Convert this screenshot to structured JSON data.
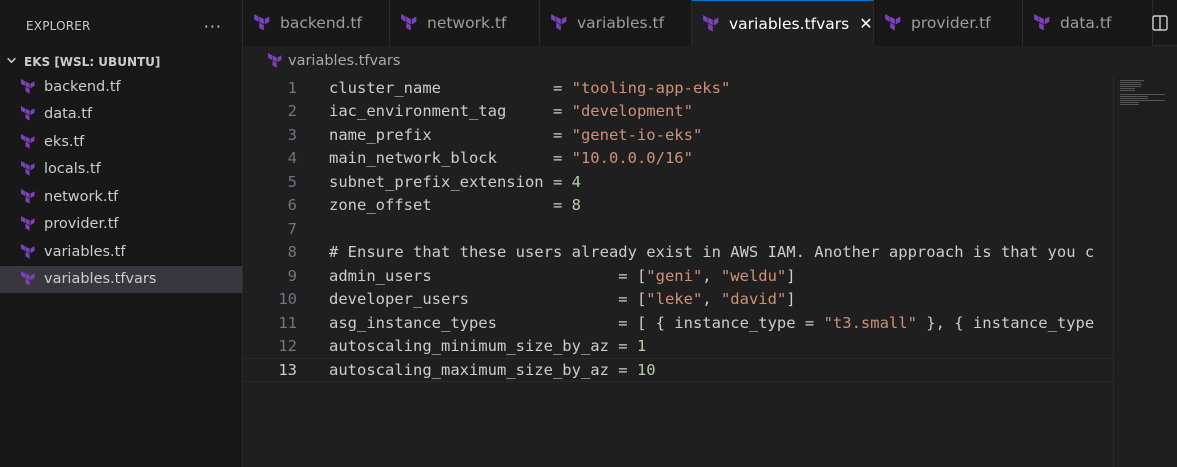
{
  "explorer": {
    "title": "EXPLORER",
    "more_label": "···",
    "folder": "EKS [WSL: UBUNTU]",
    "files": [
      {
        "name": "backend.tf"
      },
      {
        "name": "data.tf"
      },
      {
        "name": "eks.tf"
      },
      {
        "name": "locals.tf"
      },
      {
        "name": "network.tf"
      },
      {
        "name": "provider.tf"
      },
      {
        "name": "variables.tf"
      },
      {
        "name": "variables.tfvars",
        "selected": true
      }
    ]
  },
  "tabs": [
    {
      "label": "backend.tf"
    },
    {
      "label": "network.tf"
    },
    {
      "label": "variables.tf"
    },
    {
      "label": "variables.tfvars",
      "active": true,
      "close": "✕"
    },
    {
      "label": "provider.tf"
    },
    {
      "label": "data.tf"
    }
  ],
  "breadcrumb": "variables.tfvars",
  "colors": {
    "terraform": "#7b42bc",
    "accent": "#0078d4",
    "string": "#ce9178",
    "number": "#b5cea8"
  },
  "editor": {
    "current_line": "13",
    "lines": [
      {
        "n": "1",
        "parts": [
          {
            "t": "cluster_name            = "
          },
          {
            "t": "\"tooling-app-eks\"",
            "c": "str"
          }
        ]
      },
      {
        "n": "2",
        "parts": [
          {
            "t": "iac_environment_tag     = "
          },
          {
            "t": "\"development\"",
            "c": "str"
          }
        ]
      },
      {
        "n": "3",
        "parts": [
          {
            "t": "name_prefix             = "
          },
          {
            "t": "\"genet-io-eks\"",
            "c": "str"
          }
        ]
      },
      {
        "n": "4",
        "parts": [
          {
            "t": "main_network_block      = "
          },
          {
            "t": "\"10.0.0.0/16\"",
            "c": "str"
          }
        ]
      },
      {
        "n": "5",
        "parts": [
          {
            "t": "subnet_prefix_extension = "
          },
          {
            "t": "4",
            "c": "num"
          }
        ]
      },
      {
        "n": "6",
        "parts": [
          {
            "t": "zone_offset             = "
          },
          {
            "t": "8",
            "c": "num"
          }
        ]
      },
      {
        "n": "7",
        "parts": [
          {
            "t": ""
          }
        ]
      },
      {
        "n": "8",
        "parts": [
          {
            "t": "# Ensure that these users already exist in AWS IAM. Another approach is that you c",
            "c": "cmt"
          }
        ]
      },
      {
        "n": "9",
        "parts": [
          {
            "t": "admin_users                    = ["
          },
          {
            "t": "\"geni\"",
            "c": "str"
          },
          {
            "t": ", "
          },
          {
            "t": "\"weldu\"",
            "c": "str"
          },
          {
            "t": "]"
          }
        ]
      },
      {
        "n": "10",
        "parts": [
          {
            "t": "developer_users                = ["
          },
          {
            "t": "\"leke\"",
            "c": "str"
          },
          {
            "t": ", "
          },
          {
            "t": "\"david\"",
            "c": "str"
          },
          {
            "t": "]"
          }
        ]
      },
      {
        "n": "11",
        "parts": [
          {
            "t": "asg_instance_types             = [ { instance_type = "
          },
          {
            "t": "\"t3.small\"",
            "c": "str"
          },
          {
            "t": " }, { instance_type"
          }
        ]
      },
      {
        "n": "12",
        "parts": [
          {
            "t": "autoscaling_minimum_size_by_az = "
          },
          {
            "t": "1",
            "c": "num"
          }
        ]
      },
      {
        "n": "13",
        "parts": [
          {
            "t": "autoscaling_maximum_size_by_az = "
          },
          {
            "t": "10",
            "c": "num"
          }
        ]
      }
    ]
  }
}
